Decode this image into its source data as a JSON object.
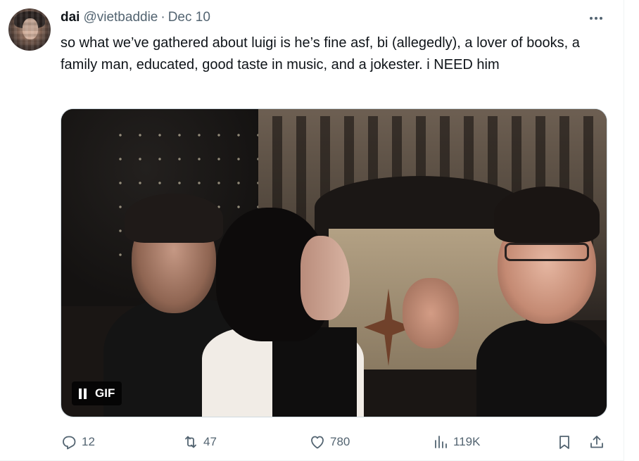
{
  "tweet": {
    "author_name": "dai",
    "handle": "@vietbaddie",
    "separator": "·",
    "date": "Dec 10",
    "text": "so what we’ve gathered about luigi is he’s fine asf, bi (allegedly), a lover of books, a family man, educated, good taste in music, and a jokester. i NEED him"
  },
  "media": {
    "badge_label": "GIF",
    "playback_icon": "pause-icon"
  },
  "actions": {
    "reply_count": "12",
    "retweet_count": "47",
    "like_count": "780",
    "views_count": "119K"
  },
  "icons": {
    "more": "more-icon",
    "reply": "reply-icon",
    "retweet": "retweet-icon",
    "like": "heart-icon",
    "views": "views-icon",
    "bookmark": "bookmark-icon",
    "share": "share-icon"
  },
  "colors": {
    "text_primary": "#0f1419",
    "text_secondary": "#536471",
    "border": "#eff3f4"
  }
}
